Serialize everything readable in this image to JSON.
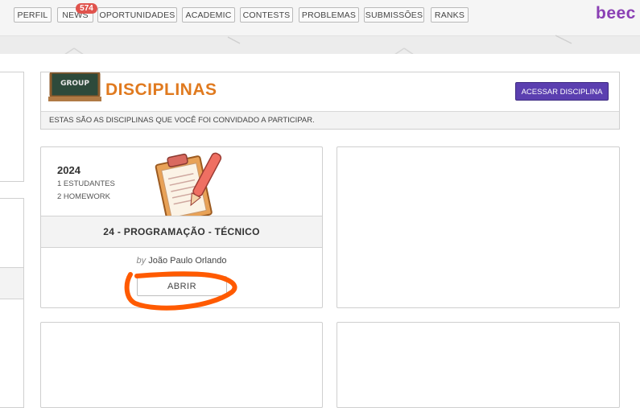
{
  "nav": {
    "items": [
      "PERFIL",
      "NEWS",
      "OPORTUNIDADES",
      "ACADEMIC",
      "CONTESTS",
      "PROBLEMAS",
      "SUBMISSÕES",
      "RANKS"
    ],
    "news_badge": "574",
    "logo": "beec"
  },
  "disciplines": {
    "illustration_text": "GROUP",
    "title": "DISCIPLINAS",
    "access_button": "ACESSAR DISCIPLINA",
    "subtitle": "ESTAS SÃO AS DISCIPLINAS QUE VOCÊ FOI CONVIDADO A PARTICIPAR."
  },
  "course_card": {
    "year": "2024",
    "students": "1 ESTUDANTES",
    "homework": "2 HOMEWORK",
    "name": "24 - PROGRAMAÇÃO - TÉCNICO",
    "by_label": "by",
    "author": "João Paulo Orlando",
    "open_button": "ABRIR"
  },
  "colors": {
    "accent_orange": "#e07a1f",
    "button_purple": "#5b3fb0",
    "logo_purple": "#8a3fb4",
    "badge_red": "#e0534d",
    "annotation_orange": "#ff5a00"
  }
}
